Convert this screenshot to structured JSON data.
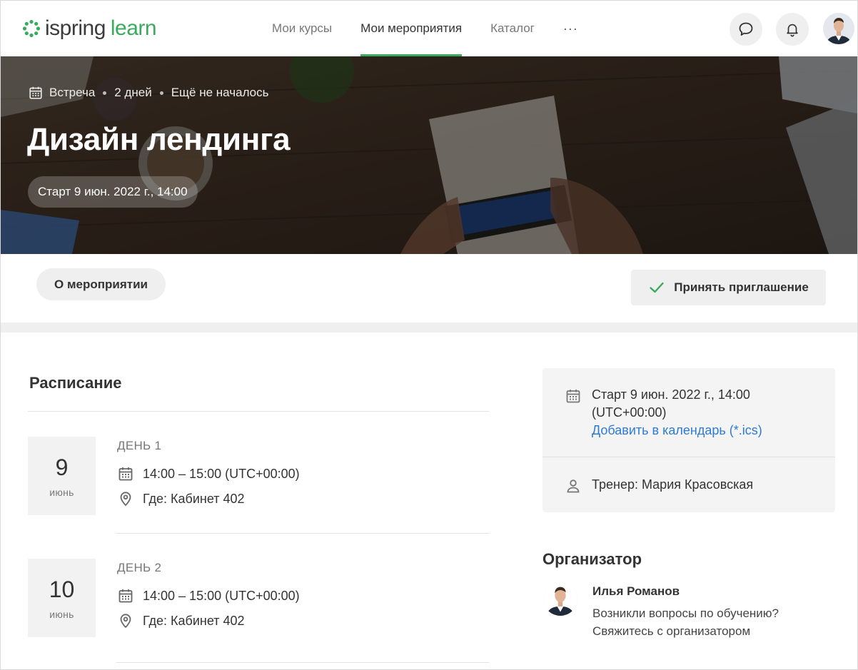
{
  "colors": {
    "brand_green": "#3aaa5c",
    "link_blue": "#2e7bd6"
  },
  "header": {
    "logo": {
      "part1": "ispring",
      "part2": "learn"
    },
    "nav": [
      {
        "label": "Мои курсы",
        "active": false
      },
      {
        "label": "Мои мероприятия",
        "active": true
      },
      {
        "label": "Каталог",
        "active": false
      }
    ],
    "more": "···",
    "icons": {
      "chat": "chat-bubble-icon",
      "bell": "bell-icon"
    }
  },
  "hero": {
    "type": "Встреча",
    "duration": "2 дней",
    "status": "Ещё не началось",
    "title": "Дизайн лендинга",
    "start": "Старт 9 июн. 2022 г., 14:00"
  },
  "actions": {
    "about": "О мероприятии",
    "accept": "Принять приглашение"
  },
  "schedule": {
    "title": "Расписание",
    "days": [
      {
        "num": "9",
        "month": "июнь",
        "label": "ДЕНЬ 1",
        "time": "14:00 – 15:00 (UTC+00:00)",
        "place": "Где: Кабинет 402"
      },
      {
        "num": "10",
        "month": "июнь",
        "label": "ДЕНЬ 2",
        "time": "14:00 – 15:00 (UTC+00:00)",
        "place": "Где: Кабинет 402"
      }
    ]
  },
  "info": {
    "start_line1": "Старт 9 июн. 2022 г., 14:00",
    "start_line2": "(UTC+00:00)",
    "add_calendar": "Добавить в календарь (*.ics)",
    "trainer": "Тренер: Мария Красовская"
  },
  "organizer": {
    "title": "Организатор",
    "name": "Илья Романов",
    "line1": "Возникли вопросы по обучению?",
    "line2": "Свяжитесь с организатором"
  }
}
